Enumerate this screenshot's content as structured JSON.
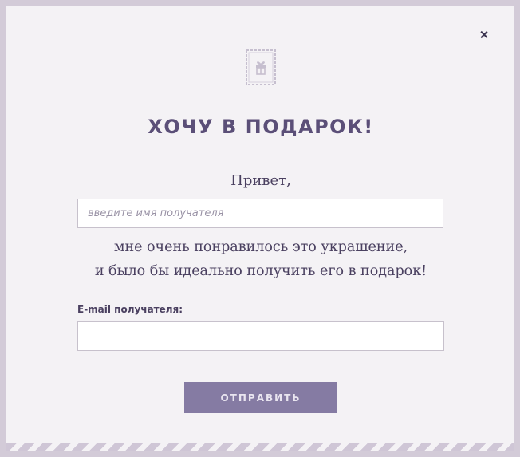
{
  "modal": {
    "close_label": "×",
    "stamp_icon": "gift-stamp-icon",
    "title": "ХОЧУ В ПОДАРОК!",
    "greeting": "Привет,",
    "name_input": {
      "placeholder": "введите имя получателя",
      "value": ""
    },
    "message": {
      "line1_prefix": "мне очень понравилось ",
      "link_text": "это украшение",
      "line1_suffix": ",",
      "line2": "и было бы идеально получить его в подарок!"
    },
    "email": {
      "label": "E-mail получателя:",
      "value": "",
      "placeholder": ""
    },
    "submit_label": "ОТПРАВИТЬ"
  },
  "colors": {
    "frame": "#d3cbd8",
    "background": "#f4f2f5",
    "title": "#5b4f78",
    "text": "#4a4060",
    "button": "#857ba3",
    "button_text": "#e9e5f0",
    "stripe": "#cfc6d6"
  }
}
